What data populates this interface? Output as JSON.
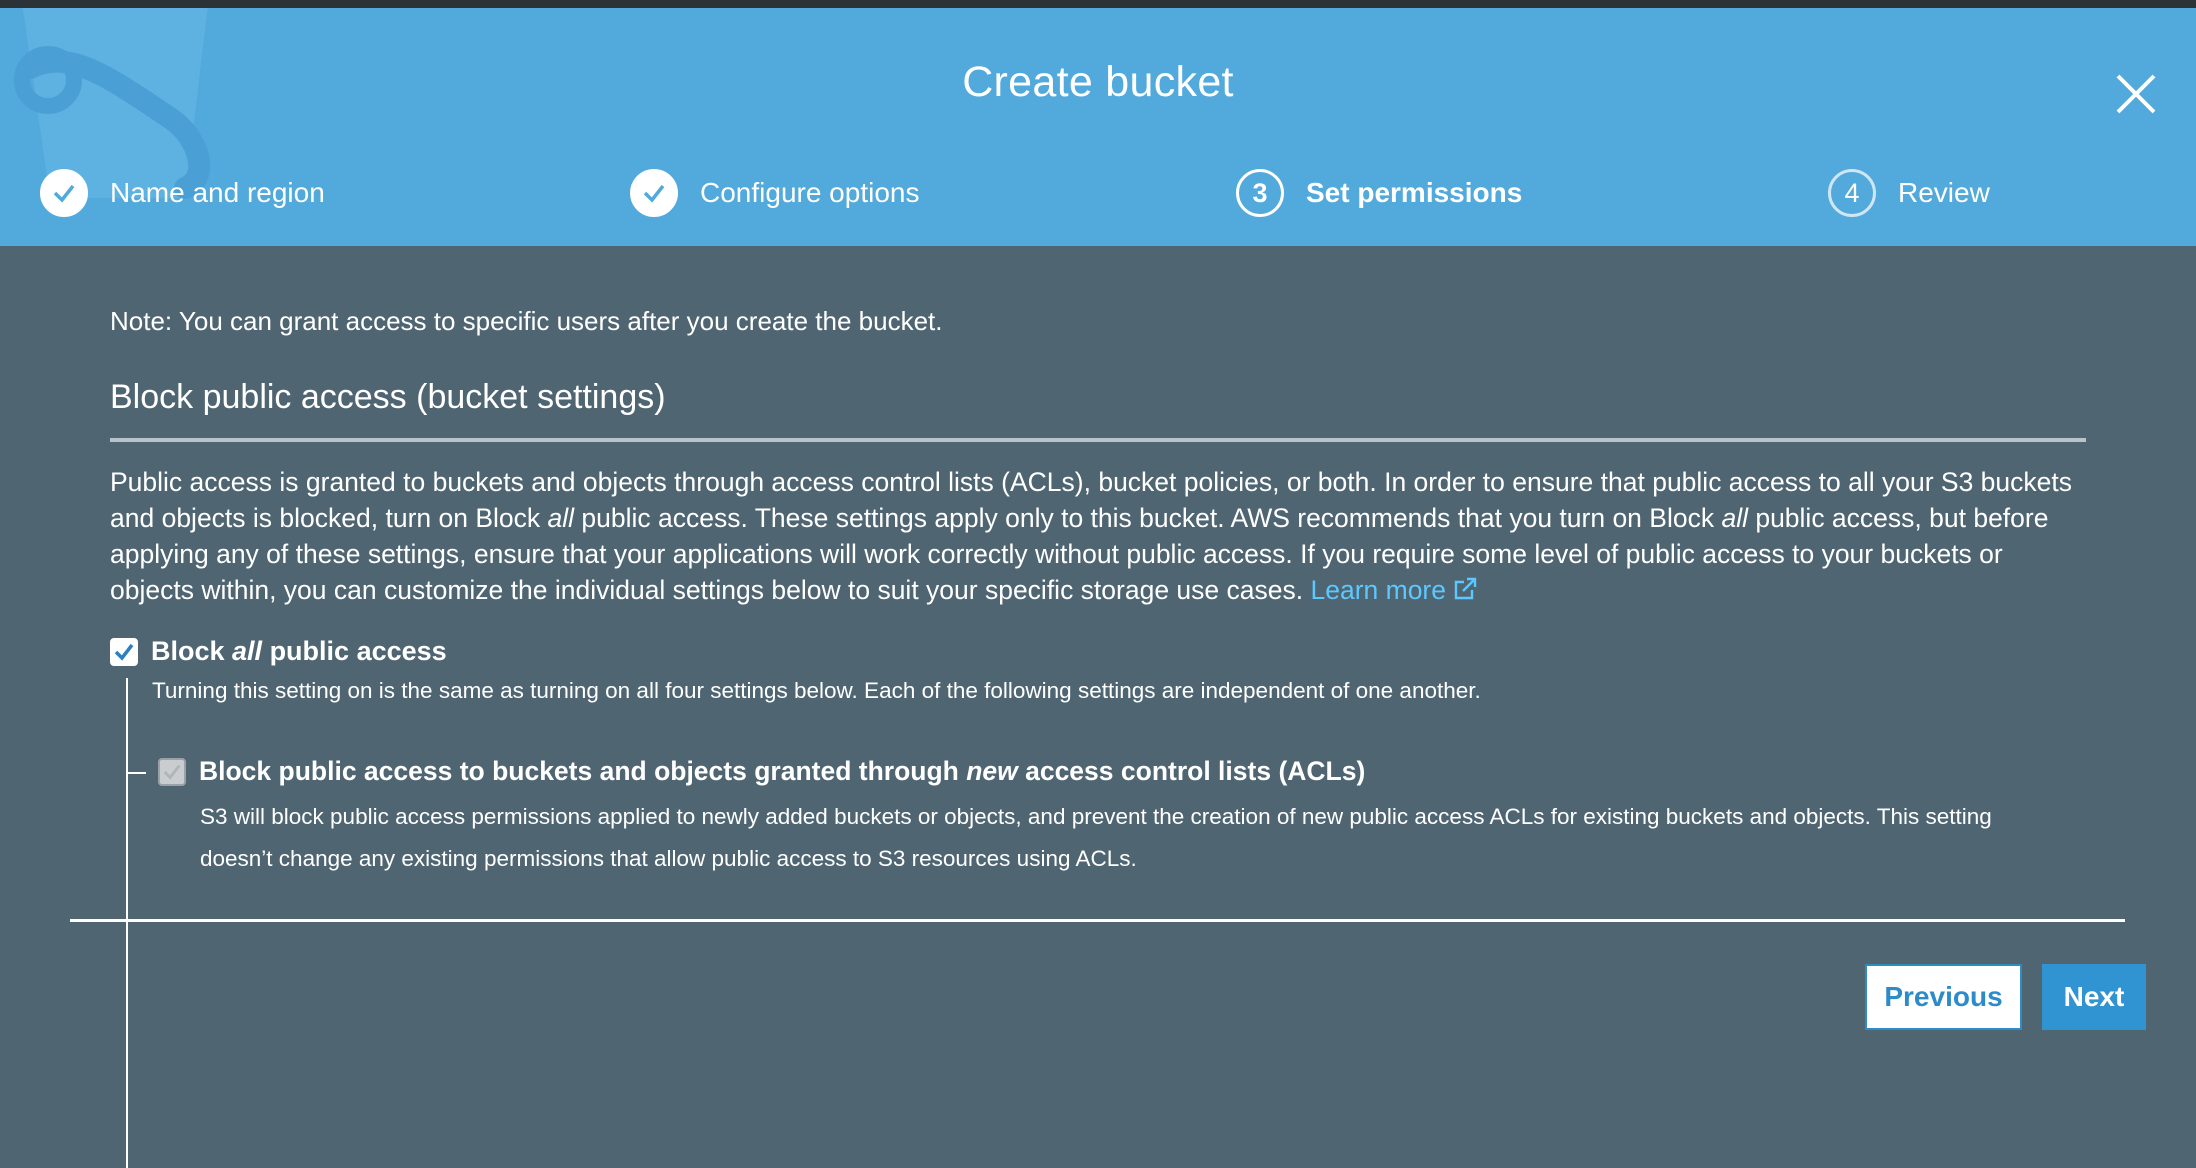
{
  "dialog": {
    "title": "Create bucket",
    "close_icon": "close-icon"
  },
  "steps": [
    {
      "label": "Name and region",
      "state": "done",
      "icon": "check-icon"
    },
    {
      "label": "Configure options",
      "state": "done",
      "icon": "check-icon"
    },
    {
      "number": "3",
      "label": "Set permissions",
      "state": "active"
    },
    {
      "number": "4",
      "label": "Review",
      "state": "pending"
    }
  ],
  "note": "Note: You can grant access to specific users after you create the bucket.",
  "section": {
    "title": "Block public access (bucket settings)",
    "description_part1": "Public access is granted to buckets and objects through access control lists (ACLs), bucket policies, or both. In order to ensure that public access to all your S3 buckets and objects is blocked, turn on Block ",
    "description_em1": "all",
    "description_part2": " public access. These settings apply only to this bucket. AWS recommends that you turn on Block ",
    "description_em2": "all",
    "description_part3": " public access, but before applying any of these settings, ensure that your applications will work correctly without public access. If you require some level of public access to your buckets or objects within, you can customize the individual settings below to suit your specific storage use cases. ",
    "learn_more": "Learn more"
  },
  "block_all": {
    "label_prefix": "Block ",
    "label_em": "all",
    "label_suffix": " public access",
    "checked": true,
    "description": "Turning this setting on is the same as turning on all four settings below. Each of the following settings are independent of one another."
  },
  "acl_setting": {
    "label_prefix": "Block public access to buckets and objects granted through ",
    "label_em": "new",
    "label_suffix": " access control lists (ACLs)",
    "checked": true,
    "disabled": true,
    "description": "S3 will block public access permissions applied to newly added buckets or objects, and prevent the creation of new public access ACLs for existing buckets and objects. This setting doesn’t change any existing permissions that allow public access to S3 resources using ACLs."
  },
  "buttons": {
    "previous": "Previous",
    "next": "Next"
  },
  "colors": {
    "header": "#52a9dc",
    "body": "#4f6572",
    "link": "#5cc8ff",
    "primary": "#3194d2"
  }
}
